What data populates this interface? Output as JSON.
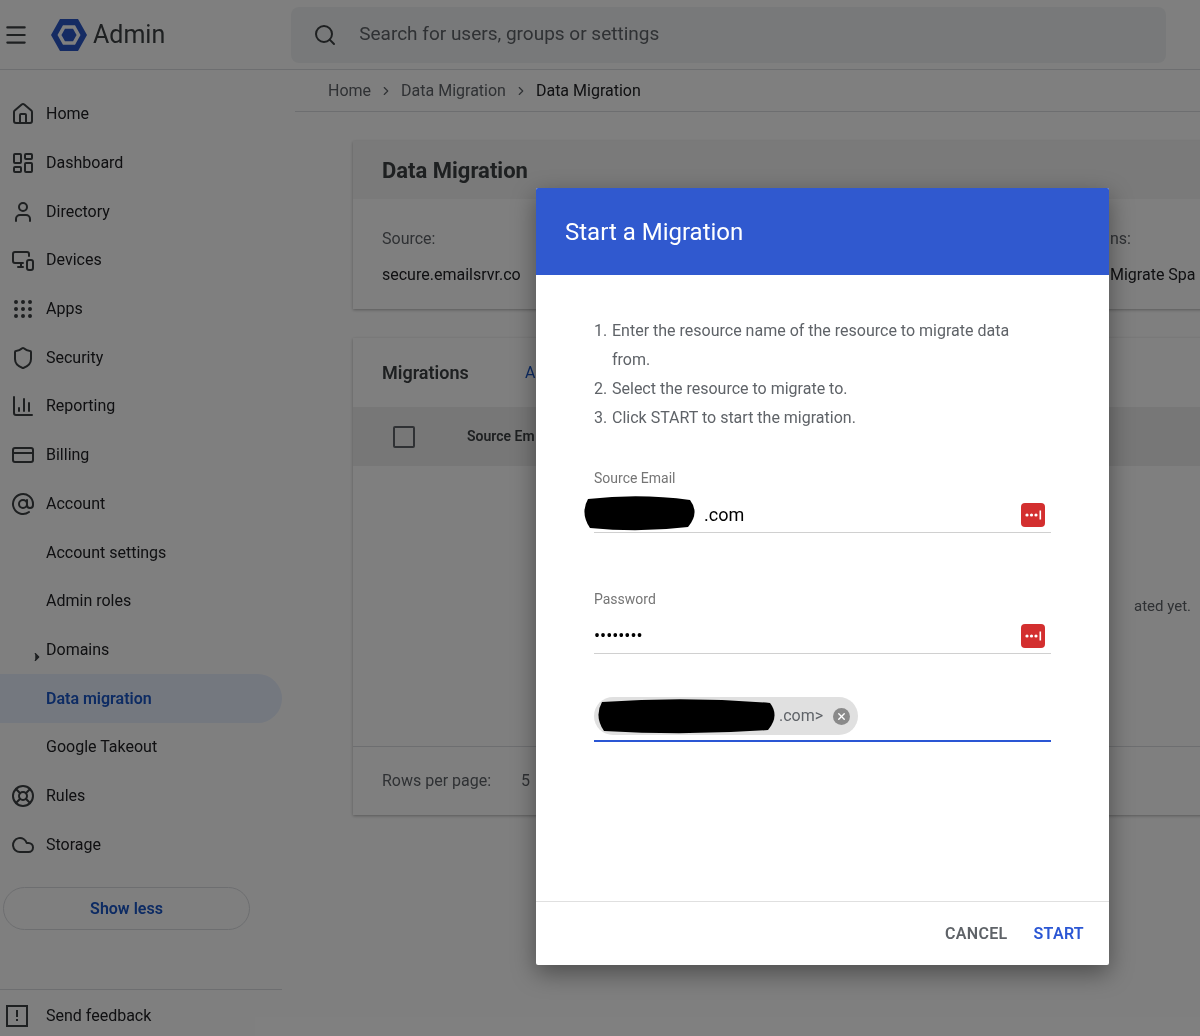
{
  "header": {
    "product": "Admin",
    "search": {
      "placeholder": "Search for users, groups or settings"
    }
  },
  "sidebar": {
    "items": [
      {
        "label": "Home",
        "selected": false
      },
      {
        "label": "Dashboard",
        "selected": false
      },
      {
        "label": "Directory",
        "selected": false
      },
      {
        "label": "Devices",
        "selected": false
      },
      {
        "label": "Apps",
        "selected": false
      },
      {
        "label": "Security",
        "selected": false
      },
      {
        "label": "Reporting",
        "selected": false
      },
      {
        "label": "Billing",
        "selected": false
      },
      {
        "label": "Account",
        "selected": false,
        "children": [
          {
            "label": "Account settings",
            "selected": false
          },
          {
            "label": "Admin roles",
            "selected": false
          },
          {
            "label": "Domains",
            "selected": false,
            "expanded": false
          },
          {
            "label": "Data migration",
            "selected": true
          },
          {
            "label": "Google Takeout",
            "selected": false
          }
        ]
      },
      {
        "label": "Rules",
        "selected": false
      },
      {
        "label": "Storage",
        "selected": false
      }
    ],
    "show_less": "Show less",
    "feedback": "Send feedback"
  },
  "breadcrumb": [
    {
      "label": "Home",
      "current": false
    },
    {
      "label": "Data Migration",
      "current": false
    },
    {
      "label": "Data Migration",
      "current": true
    }
  ],
  "summary_card": {
    "title": "Data Migration",
    "source_label": "Source:",
    "source_value": "secure.emailsrvr.co",
    "column_2_label": "ns:",
    "column_2_value": "Migrate Spa"
  },
  "migrations_card": {
    "title": "Migrations",
    "link": "A",
    "table": {
      "checked": false,
      "column_1": "Source Em",
      "empty_text": "ated yet."
    },
    "rows_per_page_label": "Rows per page:",
    "rows_per_page_value": "5"
  },
  "dialog": {
    "title": "Start a Migration",
    "steps": [
      {
        "number": "1.",
        "text": "Enter the resource name of the resource to migrate data from."
      },
      {
        "number": "2.",
        "text": "Select the resource to migrate to."
      },
      {
        "number": "3.",
        "text": "Click START to start the migration."
      }
    ],
    "fields": [
      {
        "kind": "text",
        "label": "Source Email",
        "value": ".com",
        "redacted": true,
        "focused": false
      },
      {
        "kind": "text",
        "label": "Password",
        "value": "••••••••",
        "redacted": false,
        "focused": false
      },
      {
        "kind": "chips",
        "chips": [
          {
            "text": ".com>",
            "redacted": true
          }
        ],
        "focused": true
      }
    ],
    "buttons": [
      {
        "label": "CANCEL",
        "primary": false
      },
      {
        "label": "START",
        "primary": true
      }
    ]
  }
}
